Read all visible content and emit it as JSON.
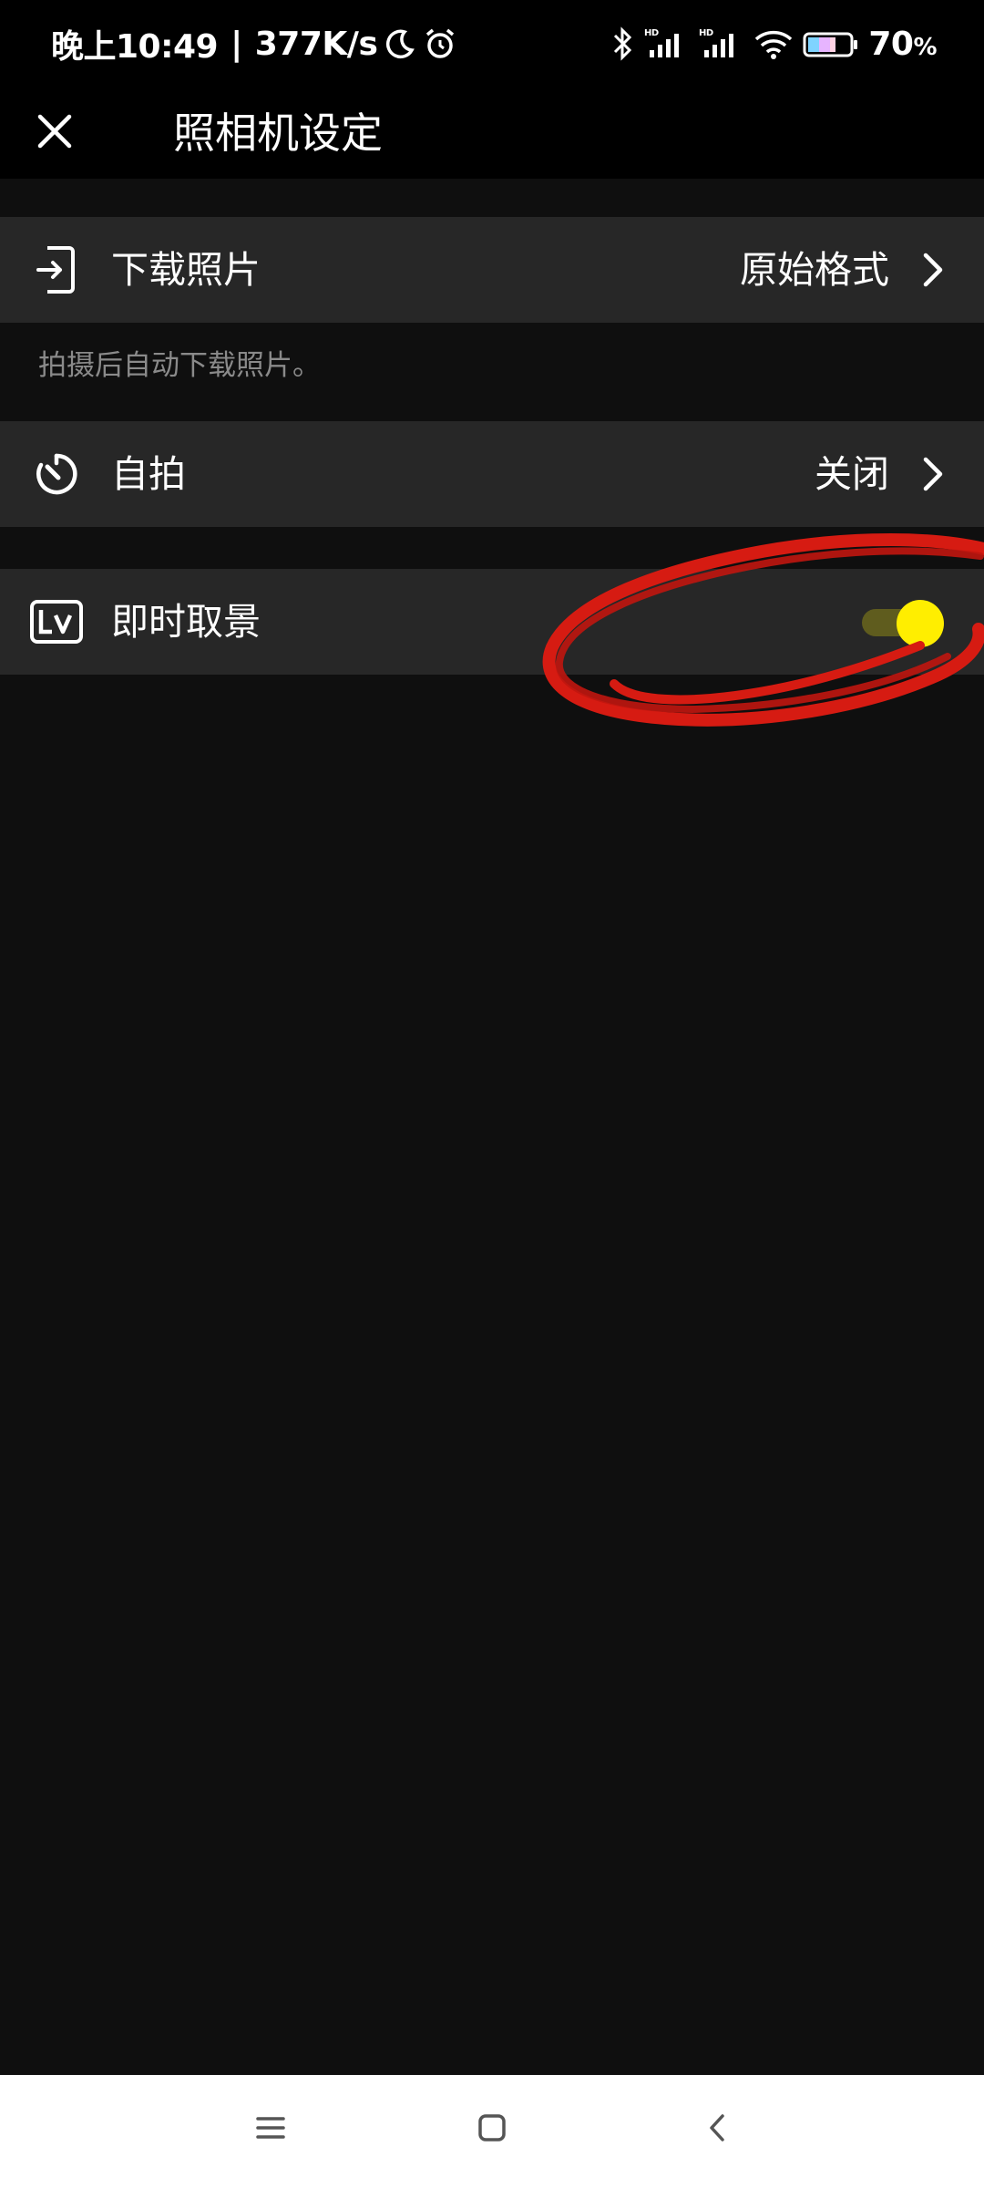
{
  "status_bar": {
    "time": "晚上10:49",
    "separator": "|",
    "net_speed": "377K/s",
    "battery": "70",
    "battery_unit": "%",
    "icons": [
      "moon-icon",
      "alarm-icon",
      "bluetooth-icon",
      "hd-signal-icon",
      "hd-signal-icon",
      "wifi-icon",
      "battery-icon"
    ]
  },
  "header": {
    "title": "照相机设定",
    "close_icon": "close-icon"
  },
  "settings": {
    "download": {
      "label": "下载照片",
      "value": "原始格式",
      "description": "拍摄后自动下载照片。",
      "icon": "download-to-phone-icon"
    },
    "self_timer": {
      "label": "自拍",
      "value": "关闭",
      "icon": "self-timer-icon"
    },
    "live_view": {
      "label": "即时取景",
      "enabled": true,
      "icon": "live-view-icon"
    }
  },
  "colors": {
    "background": "#0f0f0f",
    "row": "#272727",
    "toggle_on": "#ffee00",
    "annotation": "#d61b12"
  },
  "nav_bar": {
    "icons": [
      "menu-icon",
      "home-icon",
      "back-icon"
    ]
  }
}
